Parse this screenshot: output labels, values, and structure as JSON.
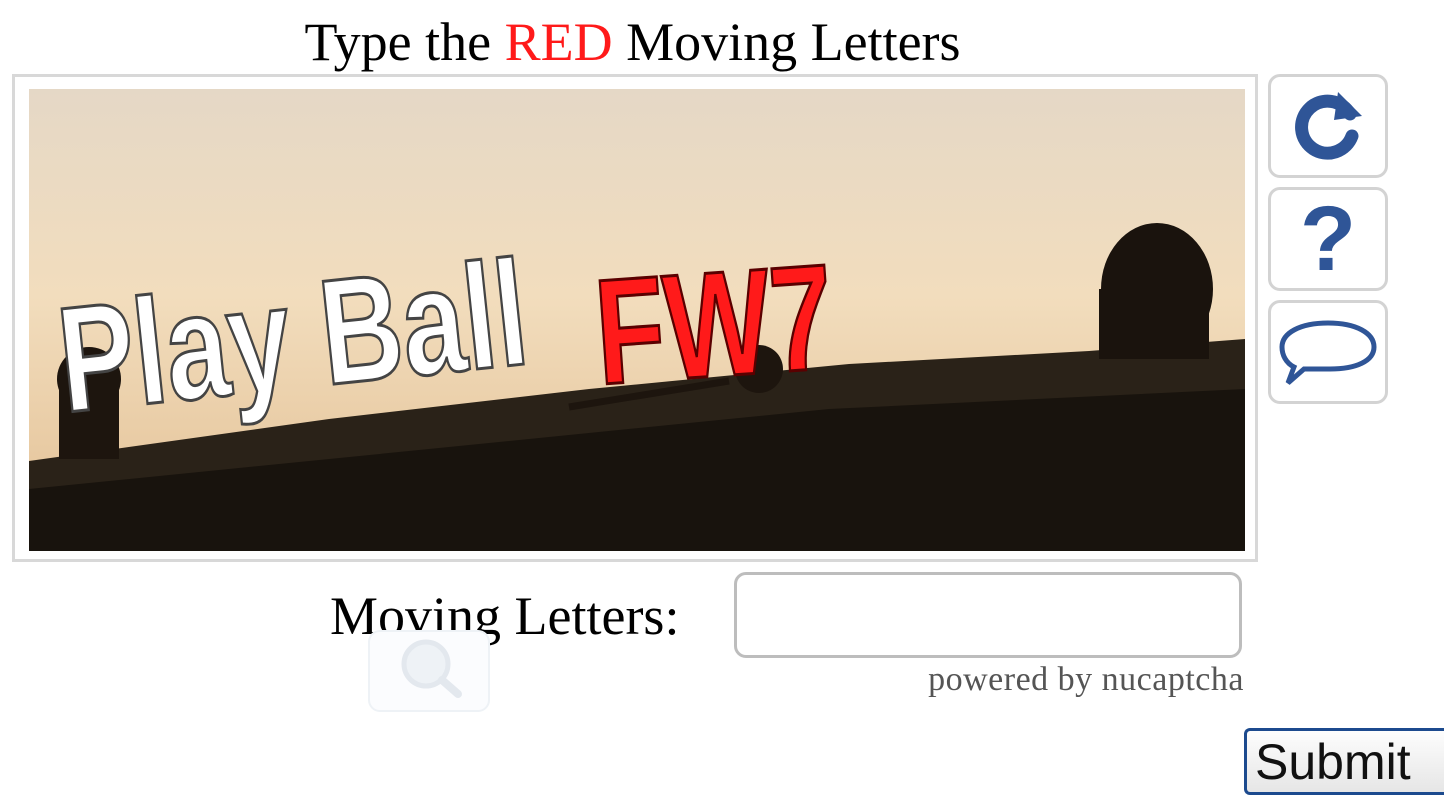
{
  "title": {
    "prefix": "Type the ",
    "highlight": "RED",
    "suffix": " Moving Letters"
  },
  "captcha": {
    "image_text_white": "Play Ball",
    "image_text_red": "FW7",
    "highlight_color": "#ff1a1a"
  },
  "side_buttons": [
    {
      "icon": "refresh-icon"
    },
    {
      "icon": "help-icon",
      "glyph": "?"
    },
    {
      "icon": "speech-bubble-icon"
    }
  ],
  "form": {
    "label": "Moving Letters:",
    "input_value": "",
    "powered_by": "powered by nucaptcha",
    "submit_label": "Submit"
  },
  "colors": {
    "icon_blue": "#2f5597",
    "submit_border": "#1c4a8e"
  }
}
